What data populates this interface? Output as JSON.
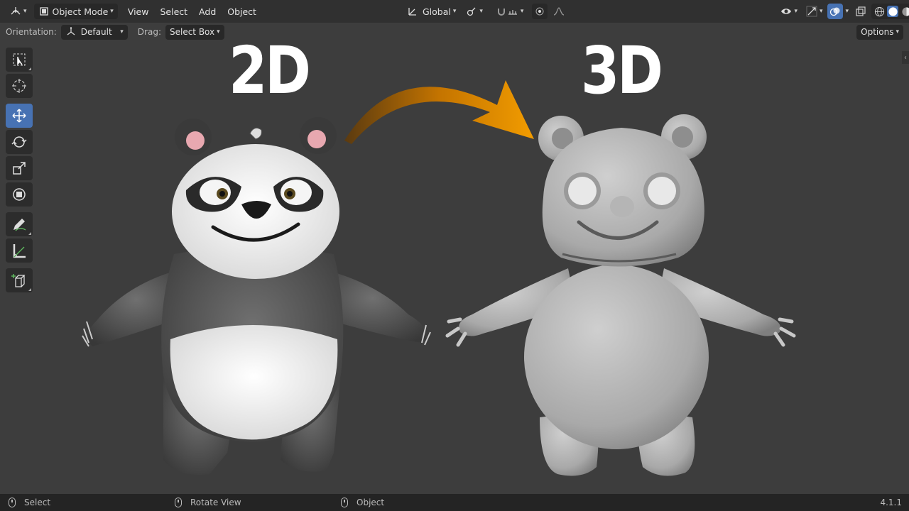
{
  "header": {
    "mode_label": "Object Mode",
    "menus": [
      "View",
      "Select",
      "Add",
      "Object"
    ],
    "transform_orientation": "Global"
  },
  "tool_settings": {
    "orientation_label": "Orientation:",
    "orientation_value": "Default",
    "drag_label": "Drag:",
    "drag_value": "Select Box",
    "options_label": "Options"
  },
  "toolbar": {
    "tools": [
      "select-box",
      "cursor",
      "move",
      "rotate",
      "scale",
      "transform",
      "annotate",
      "measure",
      "add-cube"
    ],
    "active_tool": "move"
  },
  "viewport": {
    "label_2d": "2D",
    "label_3d": "3D",
    "arrow_color": "#e88a00"
  },
  "status_bar": {
    "left_click_action": "Select",
    "middle_click_action": "Rotate View",
    "right_click_action": "Object",
    "version": "4.1.1"
  },
  "colors": {
    "accent": "#4772b3",
    "header_bg": "#303030",
    "viewport_bg": "#3d3d3d"
  }
}
